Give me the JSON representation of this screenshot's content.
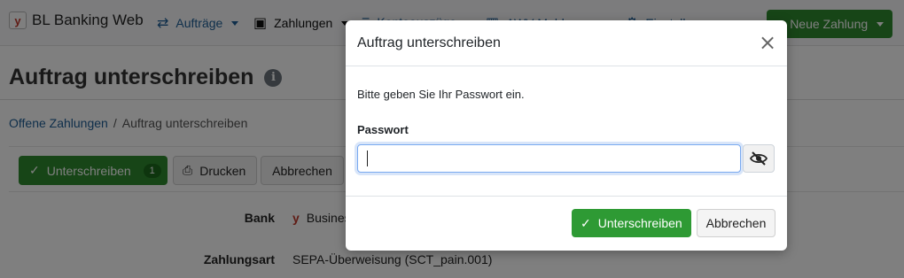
{
  "navbar": {
    "brand": "BL Banking Web",
    "brand_logo_glyph": "y",
    "items": [
      {
        "label": "Aufträge",
        "icon": "arrows-exchange-icon"
      },
      {
        "label": "Zahlungen",
        "icon": "money-icon"
      },
      {
        "label": "Kontoauszüge",
        "icon": "list-icon"
      },
      {
        "label": "AWV-Meldungen",
        "icon": "chart-icon"
      },
      {
        "label": "Einstellungen",
        "icon": "gear-icon"
      }
    ],
    "new_payment": "Neue Zahlung"
  },
  "page": {
    "title": "Auftrag unterschreiben",
    "breadcrumb": [
      "Offene Zahlungen",
      "/",
      "Auftrag unterschreiben"
    ]
  },
  "toolbar": {
    "sign_label": "Unterschreiben",
    "sign_badge": "1",
    "print_label": "Drucken",
    "cancel_label": "Abbrechen"
  },
  "details": {
    "bank_label": "Bank",
    "bank_value": "Business",
    "type_label": "Zahlungsart",
    "type_value": "SEPA-Überweisung (SCT_pain.001)"
  },
  "modal": {
    "title": "Auftrag unterschreiben",
    "prompt": "Bitte geben Sie Ihr Passwort ein.",
    "password_label": "Passwort",
    "password_value": "",
    "sign_label": "Unterschreiben",
    "cancel_label": "Abbrechen"
  },
  "colors": {
    "primary_green": "#2e8b2e",
    "link_blue": "#1e5e97",
    "focus_blue": "#7aaaf0"
  }
}
